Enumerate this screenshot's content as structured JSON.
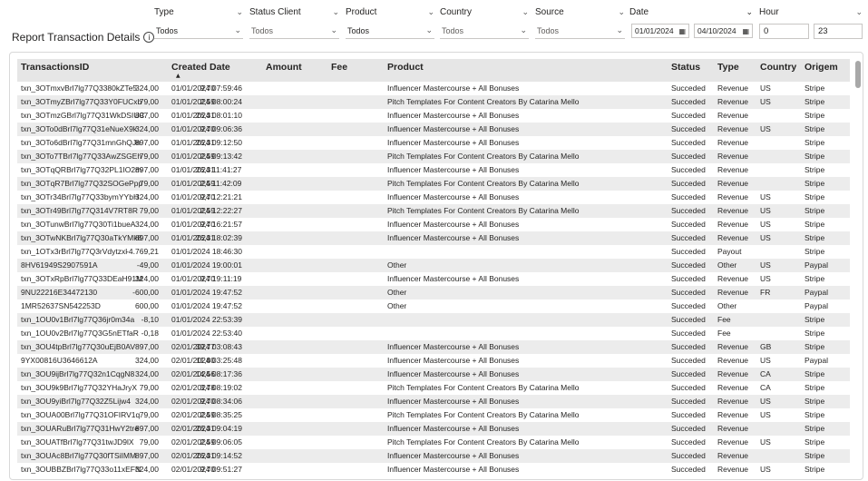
{
  "report": {
    "title": "Report Transaction Details",
    "info_glyph": "i"
  },
  "filters": [
    {
      "key": "type",
      "label": "Type",
      "value": "Todos"
    },
    {
      "key": "status_client",
      "label": "Status Client",
      "value": "Todos"
    },
    {
      "key": "product",
      "label": "Product",
      "value": "Todos"
    },
    {
      "key": "country",
      "label": "Country",
      "value": "Todos"
    },
    {
      "key": "source",
      "label": "Source",
      "value": "Todos"
    }
  ],
  "date_filter": {
    "label": "Date",
    "start": "01/01/2024",
    "end": "04/10/2024"
  },
  "hour_filter": {
    "label": "Hour",
    "min": "0",
    "max": "23"
  },
  "table": {
    "headers": [
      "TransactionsID",
      "Created Date",
      "Amount",
      "Fee",
      "Product",
      "Status",
      "Type",
      "Country",
      "Origem"
    ],
    "sort": {
      "column": "Created Date",
      "direction": "ascending"
    },
    "rows": [
      [
        "txn_3OTmxvBrl7lg77Q3380kZTe5",
        "01/01/2024 07:59:46",
        "324,00",
        "9,70",
        "Influencer Mastercourse + All Bonuses",
        "Succeded",
        "Revenue",
        "US",
        "Stripe"
      ],
      [
        "txn_3OTmyZBrl7lg77Q33Y0FUCxb",
        "01/01/2024 08:00:24",
        "79,00",
        "2,59",
        "Pitch Templates For Content Creators By Catarina Mello",
        "Succeded",
        "Revenue",
        "US",
        "Stripe"
      ],
      [
        "txn_3OTmzGBrl7lg77Q31WkDSIUC",
        "01/01/2024 08:01:10",
        "897,00",
        "26,31",
        "Influencer Mastercourse + All Bonuses",
        "Succeded",
        "Revenue",
        "",
        "Stripe"
      ],
      [
        "txn_3OTo0dBrl7lg77Q31eNueX9k",
        "01/01/2024 09:06:36",
        "324,00",
        "9,70",
        "Influencer Mastercourse + All Bonuses",
        "Succeded",
        "Revenue",
        "US",
        "Stripe"
      ],
      [
        "txn_3OTo6dBrl7lg77Q31mnGhQJn",
        "01/01/2024 09:12:50",
        "897,00",
        "26,31",
        "Influencer Mastercourse + All Bonuses",
        "Succeded",
        "Revenue",
        "",
        "Stripe"
      ],
      [
        "txn_3OTo7TBrl7lg77Q33AwZSGEh",
        "01/01/2024 09:13:42",
        "79,00",
        "2,59",
        "Pitch Templates For Content Creators By Catarina Mello",
        "Succeded",
        "Revenue",
        "",
        "Stripe"
      ],
      [
        "txn_3OTqQRBrl7lg77Q32PL1IO2m",
        "01/01/2024 11:41:27",
        "897,00",
        "26,31",
        "Influencer Mastercourse + All Bonuses",
        "Succeded",
        "Revenue",
        "",
        "Stripe"
      ],
      [
        "txn_3OTqR7Brl7lg77Q32SOGePpp",
        "01/01/2024 11:42:09",
        "79,00",
        "2,59",
        "Pitch Templates For Content Creators By Catarina Mello",
        "Succeded",
        "Revenue",
        "",
        "Stripe"
      ],
      [
        "txn_3OTr34Brl7lg77Q33bymYYbH",
        "01/01/2024 12:21:21",
        "324,00",
        "9,70",
        "Influencer Mastercourse + All Bonuses",
        "Succeded",
        "Revenue",
        "US",
        "Stripe"
      ],
      [
        "txn_3OTr49Brl7lg77Q314V7RT8R",
        "01/01/2024 12:22:27",
        "79,00",
        "2,59",
        "Pitch Templates For Content Creators By Catarina Mello",
        "Succeded",
        "Revenue",
        "US",
        "Stripe"
      ],
      [
        "txn_3OTunwBrl7lg77Q30Ti1bueA",
        "01/01/2024 16:21:57",
        "324,00",
        "9,70",
        "Influencer Mastercourse + All Bonuses",
        "Succeded",
        "Revenue",
        "US",
        "Stripe"
      ],
      [
        "txn_3OTwNKBrl7lg77Q30aTkYMk8",
        "01/01/2024 18:02:39",
        "897,00",
        "26,31",
        "Influencer Mastercourse + All Bonuses",
        "Succeded",
        "Revenue",
        "US",
        "Stripe"
      ],
      [
        "txn_1OTx3rBrl7lg77Q3rVdytzxl",
        "01/01/2024 18:46:30",
        "-4.769,21",
        "",
        "",
        "Succeded",
        "Payout",
        "",
        "Stripe"
      ],
      [
        "8HV61949S2907591A",
        "01/01/2024 19:00:01",
        "-49,00",
        "",
        "Other",
        "Succeded",
        "Other",
        "US",
        "Paypal"
      ],
      [
        "txn_3OTxRpBrl7lg77Q33DEaH91M",
        "01/01/2024 19:11:19",
        "324,00",
        "9,70",
        "Influencer Mastercourse + All Bonuses",
        "Succeded",
        "Revenue",
        "US",
        "Stripe"
      ],
      [
        "9NU22216E34472130",
        "01/01/2024 19:47:52",
        "-600,00",
        "",
        "Other",
        "Succeded",
        "Revenue",
        "FR",
        "Paypal"
      ],
      [
        "1MR52637SN542253D",
        "01/01/2024 19:47:52",
        "600,00",
        "",
        "Other",
        "Succeded",
        "Other",
        "",
        "Paypal"
      ],
      [
        "txn_1OU0v1Brl7lg77Q36jr0m34a",
        "01/01/2024 22:53:39",
        "-8,10",
        "",
        "",
        "Succeded",
        "Fee",
        "",
        "Stripe"
      ],
      [
        "txn_1OU0v2Brl7lg77Q3G5nETfaR",
        "01/01/2024 22:53:40",
        "-0,18",
        "",
        "",
        "Succeded",
        "Fee",
        "",
        "Stripe"
      ],
      [
        "txn_3OU4tpBrl7lg77Q30uEjB0AV",
        "02/01/2024 03:08:43",
        "897,00",
        "39,77",
        "Influencer Mastercourse + All Bonuses",
        "Succeded",
        "Revenue",
        "GB",
        "Stripe"
      ],
      [
        "9YX00816U3646612A",
        "02/01/2024 03:25:48",
        "324,00",
        "11,80",
        "Influencer Mastercourse + All Bonuses",
        "Succeded",
        "Revenue",
        "US",
        "Paypal"
      ],
      [
        "txn_3OU9ijBrl7lg77Q32n1CqgN8",
        "02/01/2024 08:17:36",
        "324,00",
        "14,56",
        "Influencer Mastercourse + All Bonuses",
        "Succeded",
        "Revenue",
        "CA",
        "Stripe"
      ],
      [
        "txn_3OU9k9Brl7lg77Q32YHaJryX",
        "02/01/2024 08:19:02",
        "79,00",
        "3,78",
        "Pitch Templates For Content Creators By Catarina Mello",
        "Succeded",
        "Revenue",
        "CA",
        "Stripe"
      ],
      [
        "txn_3OU9yiBrl7lg77Q32Z5Lijw4",
        "02/01/2024 08:34:06",
        "324,00",
        "9,70",
        "Influencer Mastercourse + All Bonuses",
        "Succeded",
        "Revenue",
        "US",
        "Stripe"
      ],
      [
        "txn_3OUA00Brl7lg77Q31OFIRV1q",
        "02/01/2024 08:35:25",
        "79,00",
        "2,59",
        "Pitch Templates For Content Creators By Catarina Mello",
        "Succeded",
        "Revenue",
        "US",
        "Stripe"
      ],
      [
        "txn_3OUARuBrl7lg77Q31HwY2tre",
        "02/01/2024 09:04:19",
        "897,00",
        "26,31",
        "Influencer Mastercourse + All Bonuses",
        "Succeded",
        "Revenue",
        "",
        "Stripe"
      ],
      [
        "txn_3OUATfBrl7lg77Q31twJD9lX",
        "02/01/2024 09:06:05",
        "79,00",
        "2,59",
        "Pitch Templates For Content Creators By Catarina Mello",
        "Succeded",
        "Revenue",
        "US",
        "Stripe"
      ],
      [
        "txn_3OUAc8Brl7lg77Q30fTSiIMM",
        "02/01/2024 09:14:52",
        "897,00",
        "26,31",
        "Influencer Mastercourse + All Bonuses",
        "Succeded",
        "Revenue",
        "",
        "Stripe"
      ],
      [
        "txn_3OUBBZBrl7lg77Q33o11xEFN",
        "02/01/2024 09:51:27",
        "324,00",
        "9,70",
        "Influencer Mastercourse + All Bonuses",
        "Succeded",
        "Revenue",
        "US",
        "Stripe"
      ]
    ]
  },
  "icons": {
    "dropdown": "chevron-down-icon",
    "calendar": "calendar-icon",
    "sort": "sort-ascending-icon",
    "info": "info-icon"
  }
}
